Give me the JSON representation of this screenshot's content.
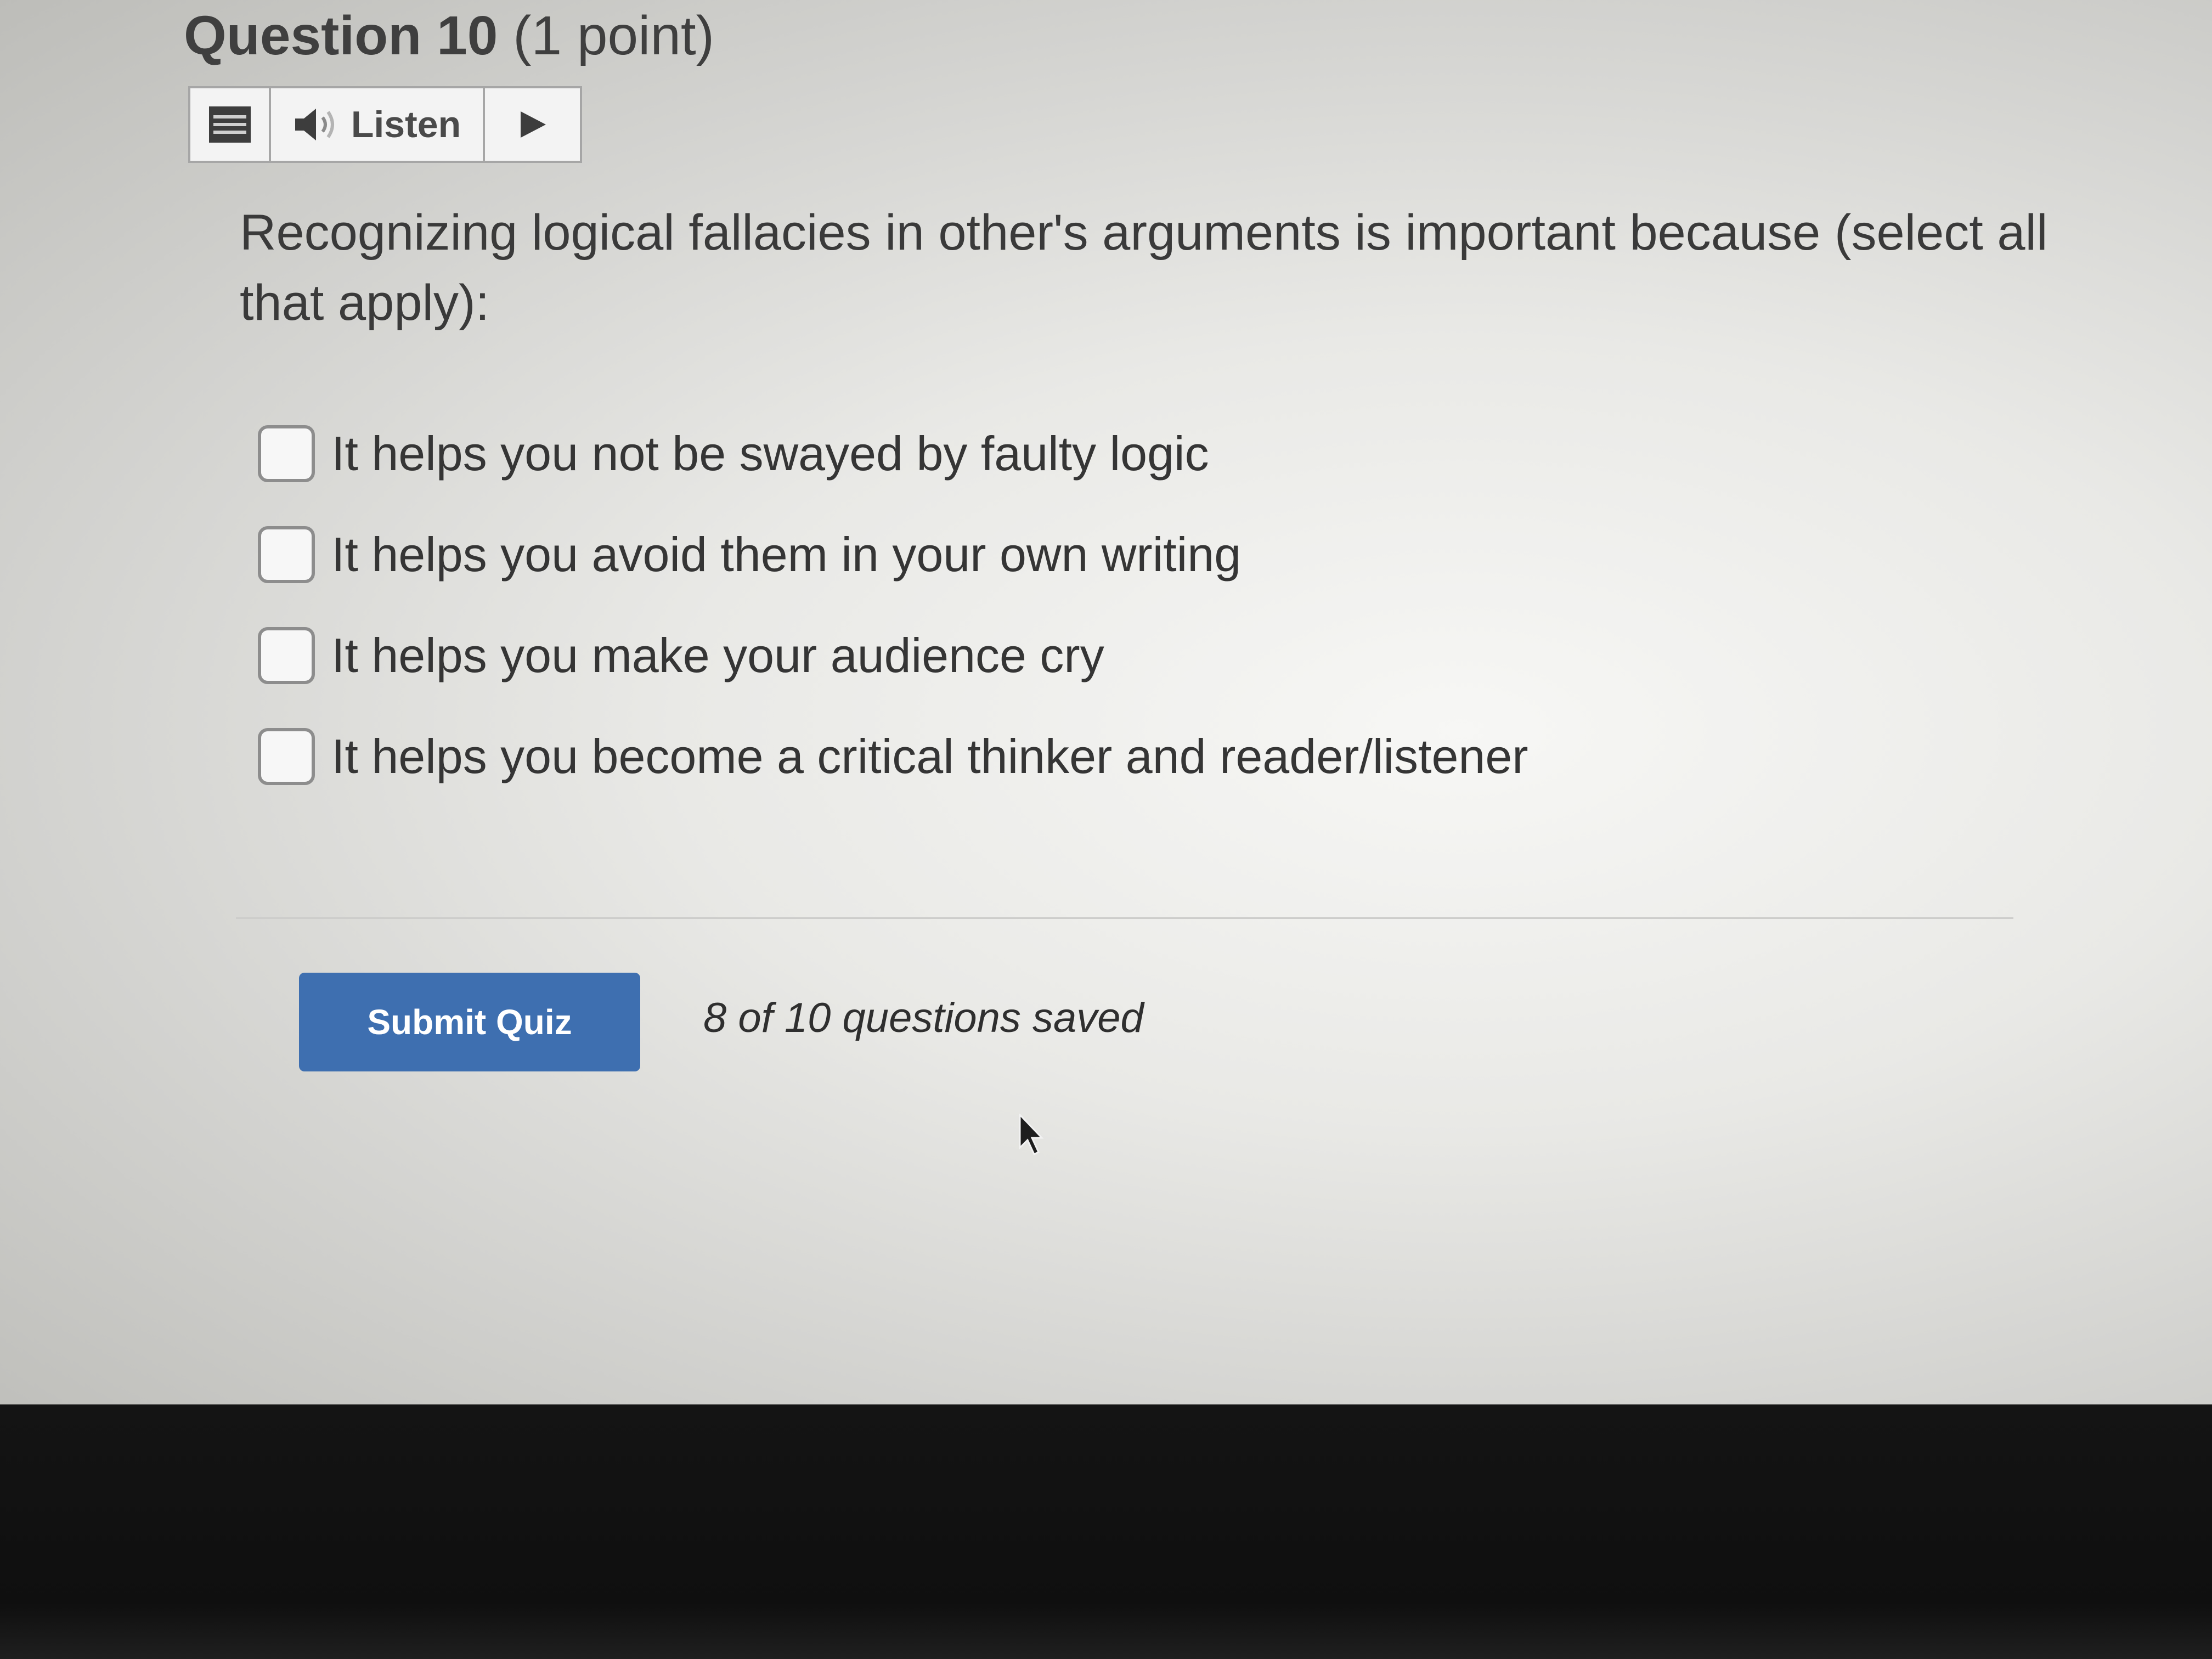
{
  "question": {
    "number_label": "Question 10",
    "points_label": "(1 point)",
    "prompt": "Recognizing logical fallacies in other's arguments is important because (select all that apply):"
  },
  "listen_toolbar": {
    "menu_icon": "menu-icon",
    "speaker_icon": "speaker-icon",
    "listen_label": "Listen",
    "play_icon": "play-icon"
  },
  "options": [
    {
      "label": "It helps you not be swayed by faulty logic",
      "checked": false
    },
    {
      "label": "It helps you avoid them in your own writing",
      "checked": false
    },
    {
      "label": "It helps you make your audience cry",
      "checked": false
    },
    {
      "label": "It helps you become a critical thinker and reader/listener",
      "checked": false
    }
  ],
  "footer": {
    "submit_label": "Submit Quiz",
    "saved_status": "8 of 10 questions saved"
  },
  "colors": {
    "submit_button": "#3e6fb0",
    "text": "#3a3a3a",
    "checkbox_border": "#8d8d8d"
  }
}
